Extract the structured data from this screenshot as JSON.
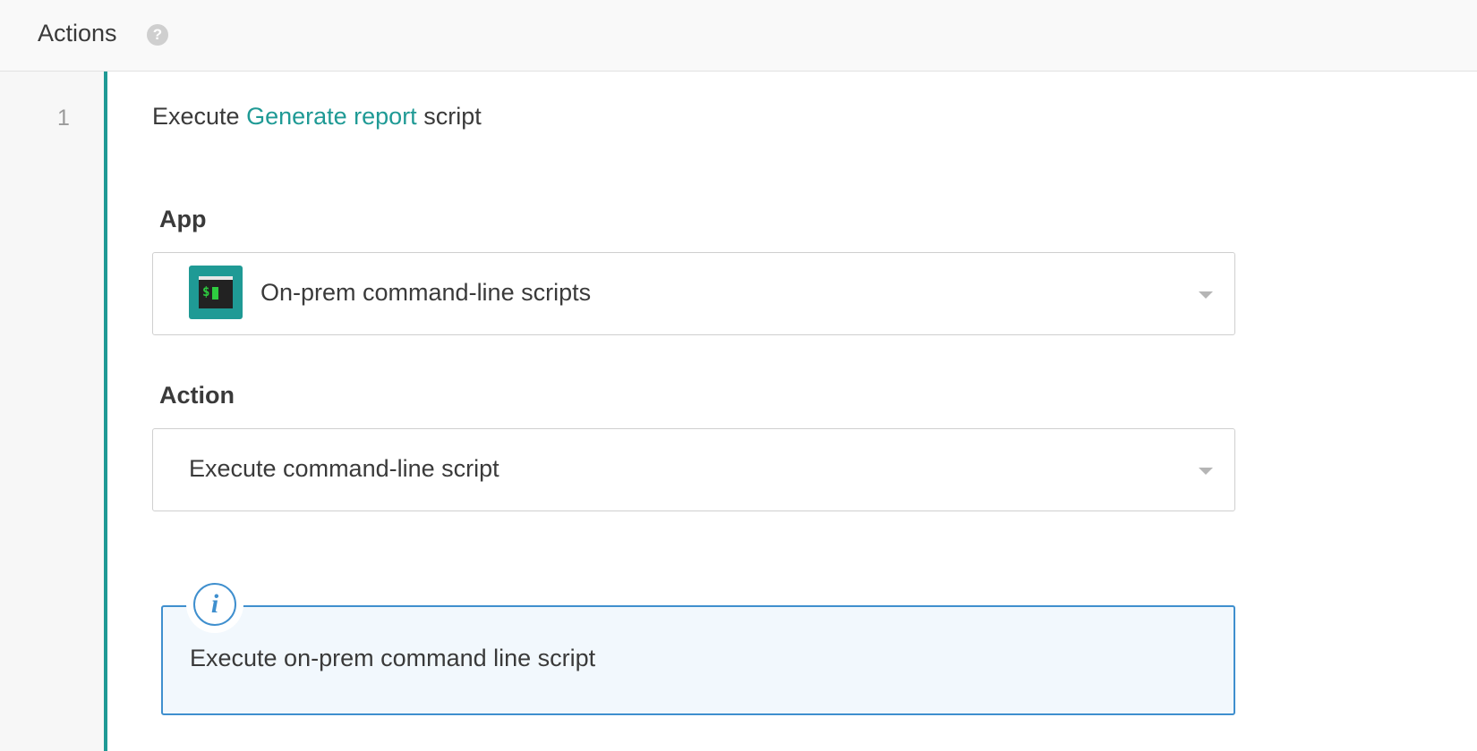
{
  "header": {
    "title": "Actions",
    "help_icon": "?"
  },
  "step": {
    "number": "1",
    "title_prefix": "Execute",
    "title_link": "Generate report",
    "title_suffix": "script",
    "accent_color": "#1f9a95"
  },
  "app_field": {
    "label": "App",
    "value": "On-prem command-line scripts",
    "icon": "terminal-app-icon",
    "icon_prompt": "$"
  },
  "action_field": {
    "label": "Action",
    "value": "Execute command-line script"
  },
  "info": {
    "icon": "i",
    "text": "Execute on-prem command line script",
    "border_color": "#3f8fce"
  }
}
